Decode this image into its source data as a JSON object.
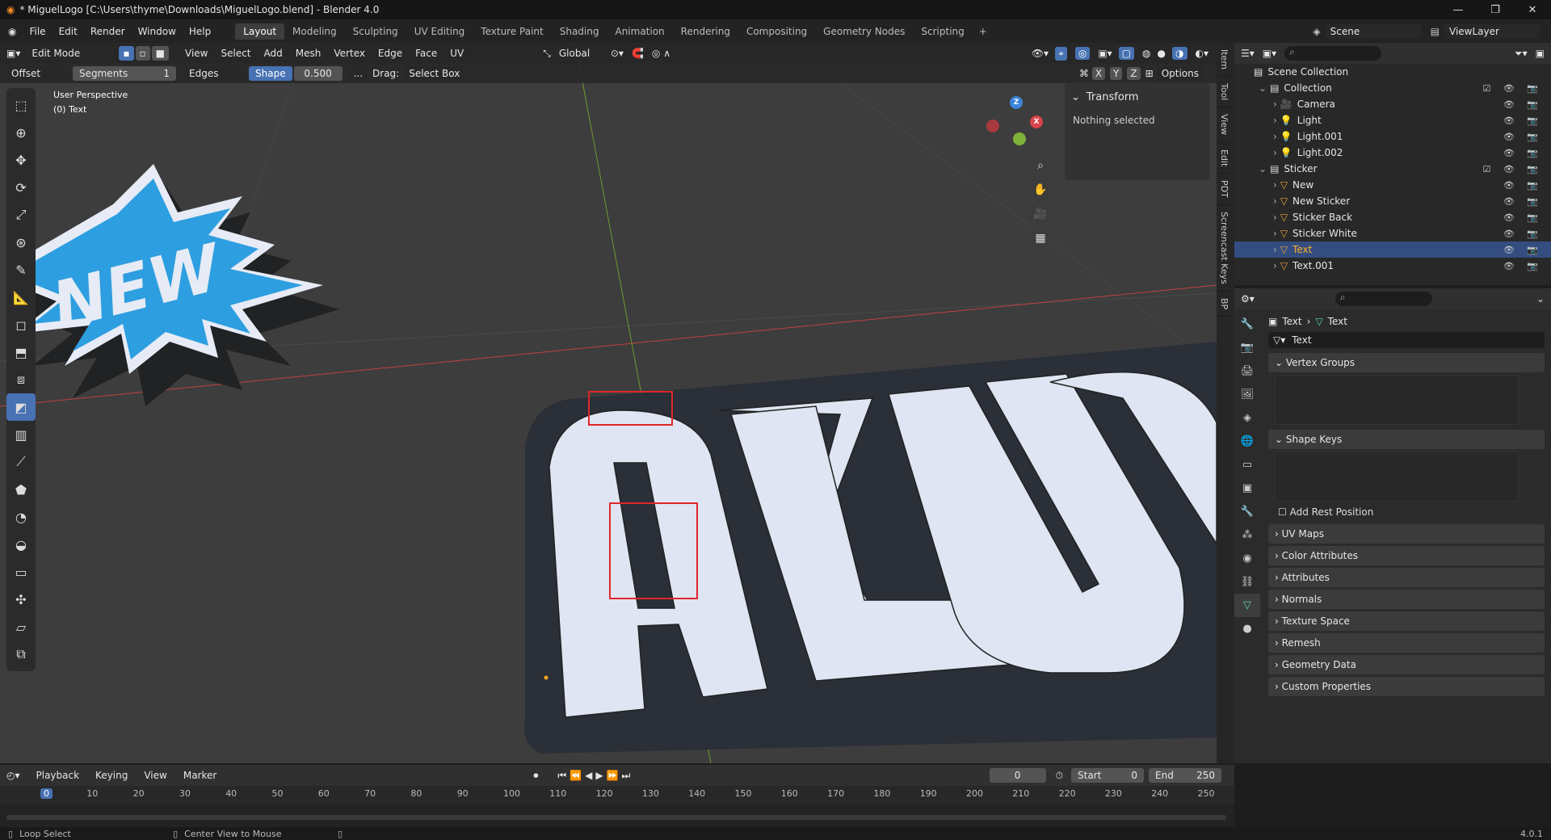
{
  "titlebar": {
    "title": "* MiguelLogo [C:\\Users\\thyme\\Downloads\\MiguelLogo.blend] - Blender 4.0",
    "min": "—",
    "max": "❐",
    "close": "✕"
  },
  "menu": [
    "File",
    "Edit",
    "Render",
    "Window",
    "Help"
  ],
  "workspaces": [
    "Layout",
    "Modeling",
    "Sculpting",
    "UV Editing",
    "Texture Paint",
    "Shading",
    "Animation",
    "Rendering",
    "Compositing",
    "Geometry Nodes",
    "Scripting"
  ],
  "workspace_add": "+",
  "scene": {
    "scene_name": "Scene",
    "view_layer": "ViewLayer"
  },
  "viewport_header": {
    "mode": "Edit Mode",
    "view": "View",
    "select": "Select",
    "add": "Add",
    "mesh": "Mesh",
    "vertex": "Vertex",
    "edge": "Edge",
    "face": "Face",
    "uv": "UV",
    "orientation": "Global"
  },
  "tool_header": {
    "offset": "Offset",
    "segments_label": "Segments",
    "segments_value": "1",
    "edges": "Edges",
    "shape_label": "Shape",
    "shape_value": "0.500",
    "more": "...",
    "drag_label": "Drag:",
    "drag_value": "Select Box",
    "x": "X",
    "y": "Y",
    "z": "Z",
    "options": "Options"
  },
  "viewport_info": {
    "perspective": "User Perspective",
    "object": "(0) Text"
  },
  "npanel": {
    "section": "Transform",
    "empty_text": "Nothing selected"
  },
  "side_tabs": [
    "Item",
    "Tool",
    "View",
    "Edit",
    "PDT",
    "Screencast Keys",
    "BP"
  ],
  "gizmo": {
    "x": "X",
    "y": "Y",
    "z": "Z"
  },
  "outliner": {
    "root": "Scene Collection",
    "rows": [
      {
        "name": "Collection",
        "indent": 1,
        "type": "collection"
      },
      {
        "name": "Camera",
        "indent": 2,
        "type": "camera"
      },
      {
        "name": "Light",
        "indent": 2,
        "type": "light"
      },
      {
        "name": "Light.001",
        "indent": 2,
        "type": "light"
      },
      {
        "name": "Light.002",
        "indent": 2,
        "type": "light"
      },
      {
        "name": "Sticker",
        "indent": 1,
        "type": "collection"
      },
      {
        "name": "New",
        "indent": 2,
        "type": "mesh"
      },
      {
        "name": "New Sticker",
        "indent": 2,
        "type": "mesh"
      },
      {
        "name": "Sticker Back",
        "indent": 2,
        "type": "mesh"
      },
      {
        "name": "Sticker White",
        "indent": 2,
        "type": "mesh"
      },
      {
        "name": "Text",
        "indent": 2,
        "type": "mesh",
        "selected": true
      },
      {
        "name": "Text.001",
        "indent": 2,
        "type": "mesh"
      }
    ]
  },
  "properties": {
    "breadcrumb_object": "Text",
    "breadcrumb_data": "Text",
    "data_name": "Text",
    "sections": [
      "Vertex Groups",
      "Shape Keys"
    ],
    "add_rest_position": "Add Rest Position",
    "collapsed_sections": [
      "UV Maps",
      "Color Attributes",
      "Attributes",
      "Normals",
      "Texture Space",
      "Remesh",
      "Geometry Data",
      "Custom Properties"
    ]
  },
  "timeline": {
    "playback": "Playback",
    "keying": "Keying",
    "view": "View",
    "marker": "Marker",
    "current_frame": "0",
    "start_label": "Start",
    "start": "0",
    "end_label": "End",
    "end": "250",
    "ticks": [
      "0",
      "10",
      "20",
      "30",
      "40",
      "50",
      "60",
      "70",
      "80",
      "90",
      "100",
      "110",
      "120",
      "130",
      "140",
      "150",
      "160",
      "170",
      "180",
      "190",
      "200",
      "210",
      "220",
      "230",
      "240",
      "250"
    ]
  },
  "statusbar": {
    "left": "Loop Select",
    "middle": "Center View to Mouse",
    "version": "4.0.1"
  },
  "colors": {
    "accent": "#4772b3",
    "selection_outline": "#e0262b",
    "x_axis": "#d9434b",
    "y_axis": "#7fb23a",
    "z_axis": "#3a84d9"
  }
}
